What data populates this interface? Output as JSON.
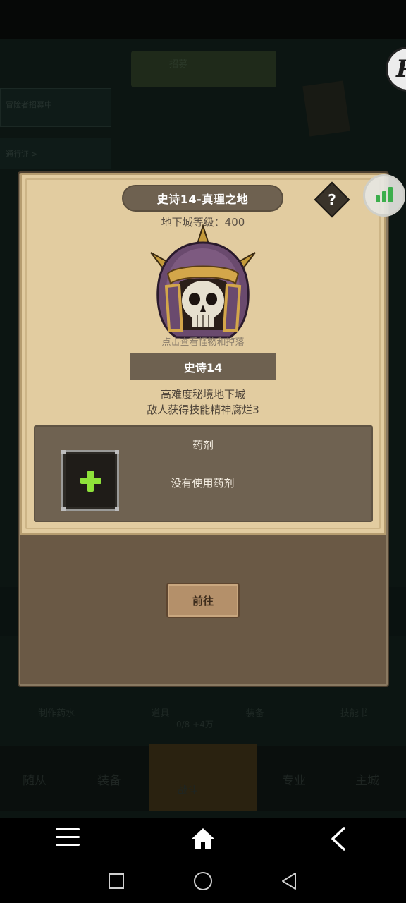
{
  "background": {
    "top_button": "招募",
    "left_panel_1": "冒险者招募中",
    "left_panel_2": "通行证 >",
    "mid_labels": [
      "制作药水",
      "道具",
      "装备",
      "技能书"
    ],
    "mid_sub": "0/8 +4万",
    "bottom_nav": [
      "随从",
      "装备",
      "战斗",
      "专业",
      "主城"
    ]
  },
  "overlay": {
    "badge_letter": "P",
    "stats_icon": "bar-chart-icon"
  },
  "dialog": {
    "title": "史诗14-真理之地",
    "help_label": "?",
    "dungeon_level": "地下城等级：400",
    "boss_hint": "点击查看怪物和掉落",
    "dungeon_name": "史诗14",
    "desc_line1": "高难度秘境地下城",
    "desc_line2": "敌人获得技能精神腐烂3",
    "potion": {
      "title": "药剂",
      "status": "没有使用药剂",
      "add_icon": "plus-icon"
    },
    "go_button": "前往"
  },
  "system_nav": {
    "icons": [
      "menu-icon",
      "home-icon",
      "back-icon",
      "recent-apps-icon",
      "home-circle-icon",
      "back-triangle-icon"
    ]
  },
  "colors": {
    "parchment": "#e2cca0",
    "plate": "#6e6150",
    "accent_green": "#8ee23a",
    "stats_green": "#3cae4c"
  }
}
